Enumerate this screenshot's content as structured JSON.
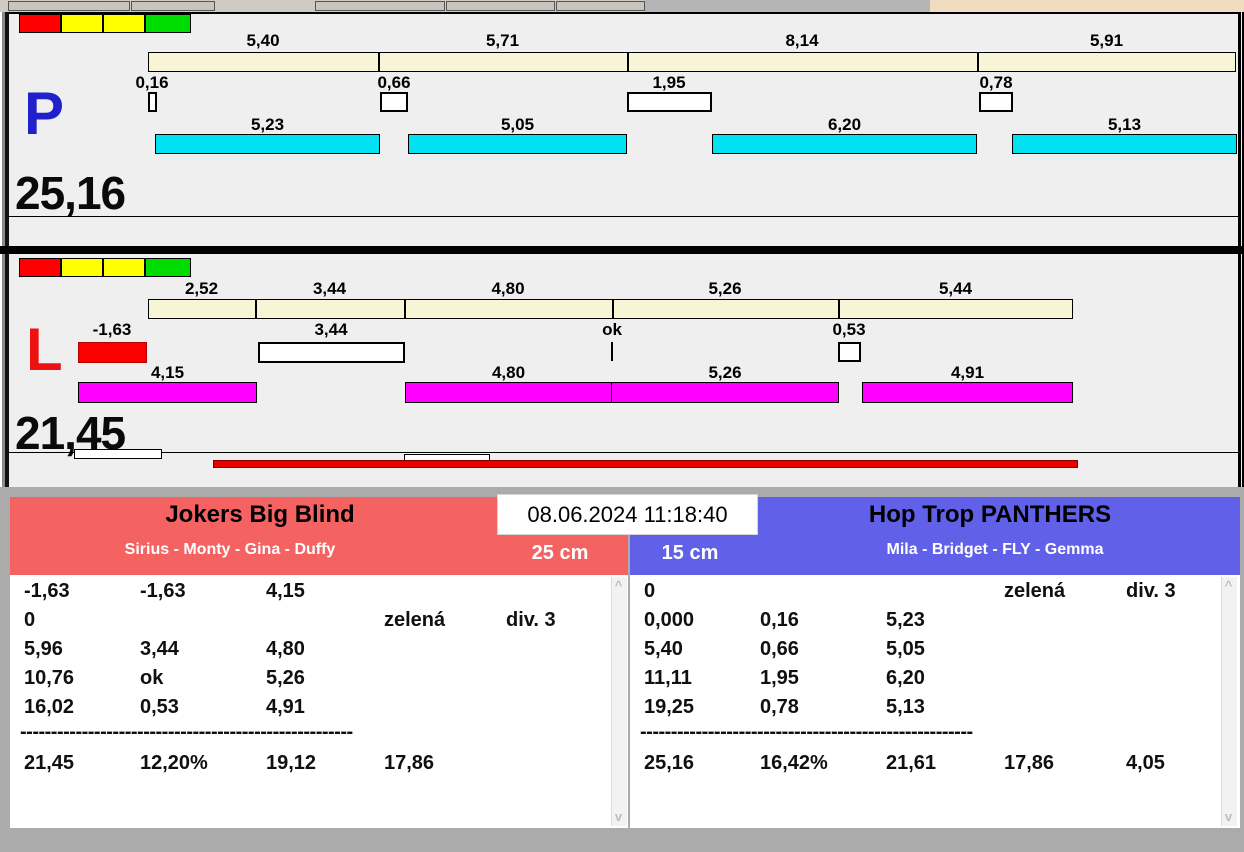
{
  "lanes": {
    "top": {
      "id": "P",
      "total": "25,16",
      "split_times": [
        "5,40",
        "5,71",
        "8,14",
        "5,91"
      ],
      "change_times": [
        "0,16",
        "0,66",
        "1,95",
        "0,78"
      ],
      "run_times": [
        "5,23",
        "5,05",
        "6,20",
        "5,13"
      ]
    },
    "bottom": {
      "id": "L",
      "total": "21,45",
      "split_times": [
        "2,52",
        "3,44",
        "4,80",
        "5,26",
        "5,44"
      ],
      "change_times": [
        "-1,63",
        "3,44",
        "ok",
        "0,53"
      ],
      "run_times": [
        "4,15",
        "4,80",
        "5,26",
        "4,91"
      ]
    }
  },
  "clock": {
    "datetime": "08.06.2024 11:18:40"
  },
  "teams": {
    "left": {
      "name": "Jokers Big Blind",
      "lineup": "Sirius - Monty - Gina - Duffy",
      "jump_height": "25 cm",
      "rows": [
        [
          "-1,63",
          "-1,63",
          "4,15",
          "",
          ""
        ],
        [
          "0",
          "",
          "",
          "zelená",
          "div. 3"
        ],
        [
          "5,96",
          "3,44",
          "4,80",
          "",
          ""
        ],
        [
          "10,76",
          "ok",
          "5,26",
          "",
          ""
        ],
        [
          "16,02",
          "0,53",
          "4,91",
          "",
          ""
        ]
      ],
      "separator": "------------------------------------------------------",
      "summary": [
        "21,45",
        "12,20%",
        "19,12",
        "17,86",
        ""
      ]
    },
    "right": {
      "name": "Hop Trop PANTHERS",
      "lineup": "Mila - Bridget - FLY - Gemma",
      "jump_height": "15 cm",
      "rows": [
        [
          "0",
          "",
          "",
          "zelená",
          "div. 3"
        ],
        [
          "0,000",
          "0,16",
          "5,23",
          "",
          ""
        ],
        [
          "5,40",
          "0,66",
          "5,05",
          "",
          ""
        ],
        [
          "11,11",
          "1,95",
          "6,20",
          "",
          ""
        ],
        [
          "19,25",
          "0,78",
          "5,13",
          "",
          ""
        ]
      ],
      "separator": "------------------------------------------------------",
      "summary": [
        "25,16",
        "16,42%",
        "21,61",
        "17,86",
        "4,05"
      ]
    }
  },
  "icons": {
    "scroll_up": "^",
    "scroll_down": "v"
  },
  "colors": {
    "split_bar": "#F7F5D6",
    "run_bar_top": "#00E2F2",
    "run_bar_bottom": "#FF00FF",
    "fault_red": "#FF0000",
    "light_yellow": "#FFFF00",
    "light_green": "#00DC00",
    "team_left_header": "#F56262",
    "team_right_header": "#6060E8",
    "lane_top_letter": "#2020CC",
    "lane_bottom_letter": "#EE1111",
    "penalty_bar": "#E60000"
  }
}
